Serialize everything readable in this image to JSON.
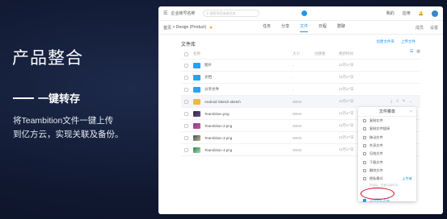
{
  "slide": {
    "title": "产品整合",
    "subtitle": "一键转存",
    "description_line1": "将Teambition文件一键上传",
    "description_line2": "到亿方云，实现关联及备份。"
  },
  "topbar": {
    "workspace": "企业账号名称",
    "search_placeholder": "搜索项目或者任务",
    "right_items": [
      "我的",
      "应用",
      "通知"
    ]
  },
  "project": {
    "breadcrumb_home": "首页",
    "breadcrumb_sep": ">",
    "name": "Design (Product)",
    "tabs": [
      "任务",
      "分享",
      "文件",
      "日程",
      "群聊"
    ],
    "active_tab": "文件",
    "right_items": [
      "成员",
      "设置"
    ]
  },
  "library": {
    "title": "文件库",
    "actions": [
      "创建文件夹",
      "上传文件"
    ],
    "columns": [
      "名称",
      "大小",
      "创建者",
      "更新时间"
    ],
    "rows": [
      {
        "name": "图片",
        "size": "-",
        "creator": "",
        "updated": "11月17日",
        "type": "folder"
      },
      {
        "name": "文档",
        "size": "-",
        "creator": "",
        "updated": "11月17日",
        "type": "folder"
      },
      {
        "name": "分享文件",
        "size": "-",
        "creator": "",
        "updated": "11月17日",
        "type": "folder"
      },
      {
        "name": "Android Sketch.sketch",
        "size": "88KB",
        "creator": "",
        "updated": "11月17日",
        "type": "sketch"
      },
      {
        "name": "Teambition.png",
        "size": "88KB",
        "creator": "",
        "updated": "11月17日",
        "type": "img1"
      },
      {
        "name": "Teambition 2.png",
        "size": "88KB",
        "creator": "",
        "updated": "11月17日",
        "type": "img2"
      },
      {
        "name": "Teambition 3.png",
        "size": "88KB",
        "creator": "",
        "updated": "11月17日",
        "type": "img3"
      },
      {
        "name": "Teambition 4.png",
        "size": "88KB",
        "creator": "",
        "updated": "11月17日",
        "type": "img4"
      }
    ]
  },
  "file_menu": {
    "title": "文件菜单",
    "items": [
      "复制文件",
      "复制文件链接",
      "移动文件",
      "共享文件",
      "归档文件",
      "下载文件",
      "删除文件"
    ],
    "notify_label": "隐私模式",
    "notify_right": "上传者",
    "notify_note": "开启后，仅参与者可见",
    "upload_label": "上传到亿方云"
  },
  "colors": {
    "accent": "#1b9aee",
    "highlight": "#d0021b",
    "background": "#101830"
  }
}
